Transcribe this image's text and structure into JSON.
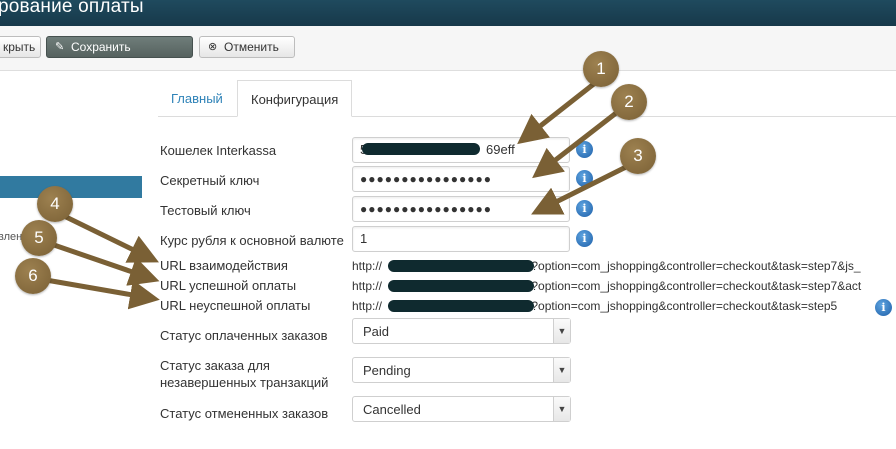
{
  "title": "рование оплаты",
  "toolbar": {
    "close_label": "крыть",
    "save_label": "Сохранить",
    "cancel_label": "Отменить"
  },
  "sidebar": {
    "fragment": "влен"
  },
  "tabs": [
    {
      "label": "Главный",
      "active": false
    },
    {
      "label": "Конфигурация",
      "active": true
    }
  ],
  "form": {
    "wallet_label": "Кошелек Interkassa",
    "wallet_value_visible": "69eff",
    "wallet_prefix_visible": "5",
    "secret_label": "Секретный ключ",
    "secret_value": "●●●●●●●●●●●●●●●●",
    "test_label": "Тестовый ключ",
    "test_value": "●●●●●●●●●●●●●●●●",
    "rate_label": "Курс рубля к основной валюте",
    "rate_value": "1",
    "url_interaction_label": "URL взаимодействия",
    "url_interaction_prefix": "http://",
    "url_interaction_suffix": "/?option=com_jshopping&controller=checkout&task=step7&js_",
    "url_success_label": "URL успешной оплаты",
    "url_success_prefix": "http://",
    "url_success_suffix": "/?option=com_jshopping&controller=checkout&task=step7&act",
    "url_fail_label": "URL неуспешной оплаты",
    "url_fail_prefix": "http://",
    "url_fail_suffix": "/?option=com_jshopping&controller=checkout&task=step5",
    "paid_status_label": "Статус оплаченных заказов",
    "paid_status_value": "Paid",
    "pending_status_label_line1": "Статус заказа для",
    "pending_status_label_line2": "незавершенных транзакций",
    "pending_status_value": "Pending",
    "cancelled_status_label": "Статус отмененных заказов",
    "cancelled_status_value": "Cancelled"
  },
  "annotations": [
    "1",
    "2",
    "3",
    "4",
    "5",
    "6"
  ],
  "colors": {
    "titlebar": "#1f4a5e",
    "annotation": "#8a6d3b",
    "link": "#2f83b8",
    "sidebar_active": "#317aa0"
  }
}
